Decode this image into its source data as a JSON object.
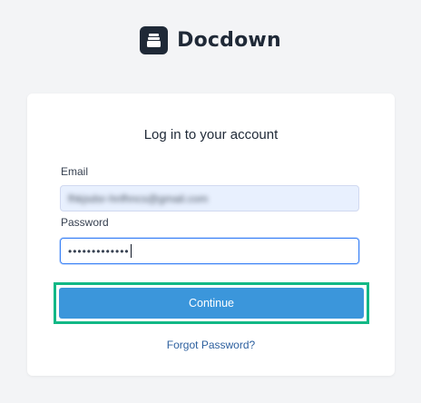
{
  "brand": {
    "name": "Docdown",
    "logo_icon": "book-stack-icon"
  },
  "card": {
    "title": "Log in to your account",
    "email_label": "Email",
    "email_value": "fhkjsdsr-hnfhncs@gmail.com",
    "password_label": "Password",
    "password_value": "•••••••••••••",
    "continue_label": "Continue",
    "forgot_label": "Forgot Password?"
  },
  "colors": {
    "background": "#f3f4f6",
    "brand_dark": "#1f2937",
    "button": "#3b96db",
    "highlight_border": "#12b886",
    "link": "#2c5f9e"
  }
}
